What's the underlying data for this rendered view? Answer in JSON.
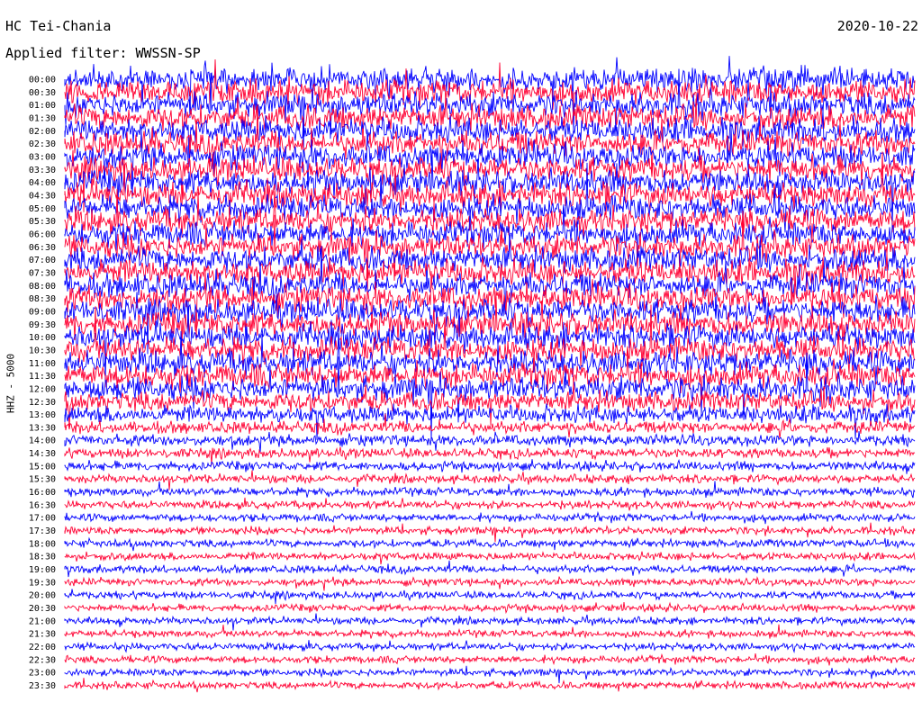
{
  "header": {
    "station": "HC Tei-Chania",
    "filter": "Applied filter: WWSSN-SP",
    "date": "2020-10-22"
  },
  "colors": {
    "trace_a": "#0000ff",
    "trace_b": "#ff0033",
    "background": "#ffffff"
  },
  "chart_data": {
    "type": "line",
    "title": "HC Tei-Chania",
    "ylabel": "HHZ - 5000",
    "row_labels": [
      "00:00",
      "00:30",
      "01:00",
      "01:30",
      "02:00",
      "02:30",
      "03:00",
      "03:30",
      "04:00",
      "04:30",
      "05:00",
      "05:30",
      "06:00",
      "06:30",
      "07:00",
      "07:30",
      "08:00",
      "08:30",
      "09:00",
      "09:30",
      "10:00",
      "10:30",
      "11:00",
      "11:30",
      "12:00",
      "12:30",
      "13:00",
      "13:30",
      "14:00",
      "14:30",
      "15:00",
      "15:30",
      "16:00",
      "16:30",
      "17:00",
      "17:30",
      "18:00",
      "18:30",
      "19:00",
      "19:30",
      "20:00",
      "20:30",
      "21:00",
      "21:30",
      "22:00",
      "22:30",
      "23:00",
      "23:30"
    ],
    "series_colors": [
      "blue",
      "red"
    ],
    "relative_noise_amplitude": [
      1.0,
      1.0,
      1.0,
      1.0,
      1.0,
      1.0,
      1.0,
      1.0,
      1.0,
      1.0,
      1.0,
      1.0,
      1.0,
      1.0,
      1.0,
      1.0,
      1.0,
      1.0,
      1.0,
      1.0,
      1.0,
      1.0,
      1.0,
      1.0,
      1.0,
      0.8,
      0.7,
      0.5,
      0.45,
      0.4,
      0.38,
      0.35,
      0.35,
      0.33,
      0.32,
      0.32,
      0.32,
      0.32,
      0.32,
      0.3,
      0.3,
      0.3,
      0.3,
      0.3,
      0.3,
      0.3,
      0.3,
      0.3
    ],
    "grid": false
  }
}
